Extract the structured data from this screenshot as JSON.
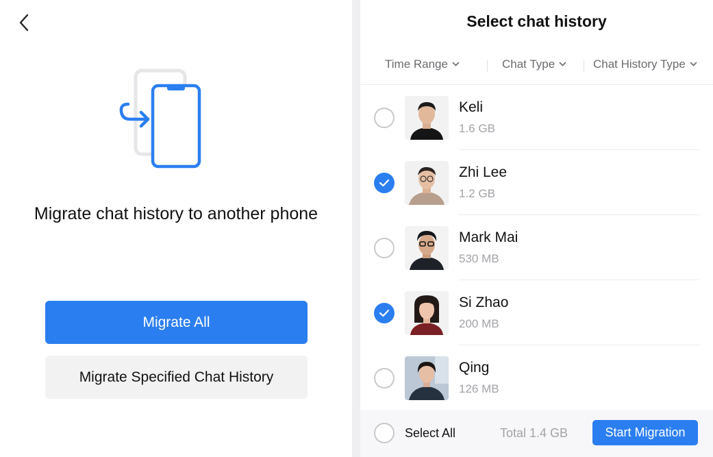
{
  "left": {
    "headline": "Migrate chat history to another phone",
    "migrate_all_label": "Migrate All",
    "migrate_specified_label": "Migrate Specified Chat History",
    "back_icon": "chevron-left-icon",
    "illustration_icon": "phone-transfer-icon"
  },
  "right": {
    "title": "Select chat history",
    "filters": [
      {
        "label": "Time Range",
        "icon": "chevron-down-icon"
      },
      {
        "label": "Chat Type",
        "icon": "chevron-down-icon"
      },
      {
        "label": "Chat History Type",
        "icon": "chevron-down-icon"
      }
    ],
    "contacts": [
      {
        "name": "Keli",
        "size": "1.6 GB",
        "selected": false
      },
      {
        "name": "Zhi Lee",
        "size": "1.2 GB",
        "selected": true
      },
      {
        "name": "Mark Mai",
        "size": "530 MB",
        "selected": false
      },
      {
        "name": "Si Zhao",
        "size": "200 MB",
        "selected": true
      },
      {
        "name": "Qing",
        "size": "126 MB",
        "selected": false
      }
    ],
    "footer": {
      "select_all_label": "Select All",
      "total_label": "Total 1.4 GB",
      "start_label": "Start Migration"
    }
  },
  "colors": {
    "accent": "#2b7ef0",
    "secondary_button": "#f2f2f3",
    "muted_text": "#a3a3a8"
  }
}
